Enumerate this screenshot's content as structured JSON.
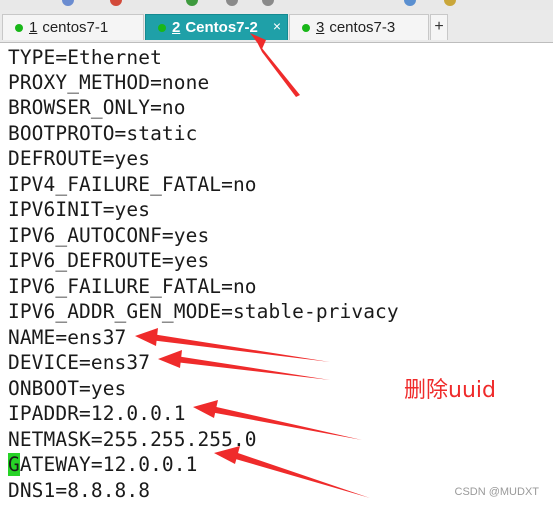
{
  "tabs": [
    {
      "number": "1",
      "label": "centos7-1",
      "active": false
    },
    {
      "number": "2",
      "label": "Centos7-2",
      "active": true
    },
    {
      "number": "3",
      "label": "centos7-3",
      "active": false
    }
  ],
  "tab_close_glyph": "×",
  "tab_add_glyph": "+",
  "terminal": {
    "lines": [
      "TYPE=Ethernet",
      "PROXY_METHOD=none",
      "BROWSER_ONLY=no",
      "BOOTPROTO=static",
      "DEFROUTE=yes",
      "IPV4_FAILURE_FATAL=no",
      "IPV6INIT=yes",
      "IPV6_AUTOCONF=yes",
      "IPV6_DEFROUTE=yes",
      "IPV6_FAILURE_FATAL=no",
      "IPV6_ADDR_GEN_MODE=stable-privacy",
      "NAME=ens37",
      "DEVICE=ens37",
      "ONBOOT=yes",
      "IPADDR=12.0.0.1",
      "NETMASK=255.255.255.0",
      "ATEWAY=12.0.0.1",
      "DNS1=8.8.8.8"
    ],
    "cursor_char": "G"
  },
  "annotation": {
    "text": "删除uuid",
    "color": "#ef2b2b"
  },
  "watermark": "CSDN @MUDXT",
  "colors": {
    "active_tab": "#1fa0a8",
    "status_dot": "#19b719",
    "cursor": "#27d327",
    "arrow": "#ef2b2b"
  }
}
